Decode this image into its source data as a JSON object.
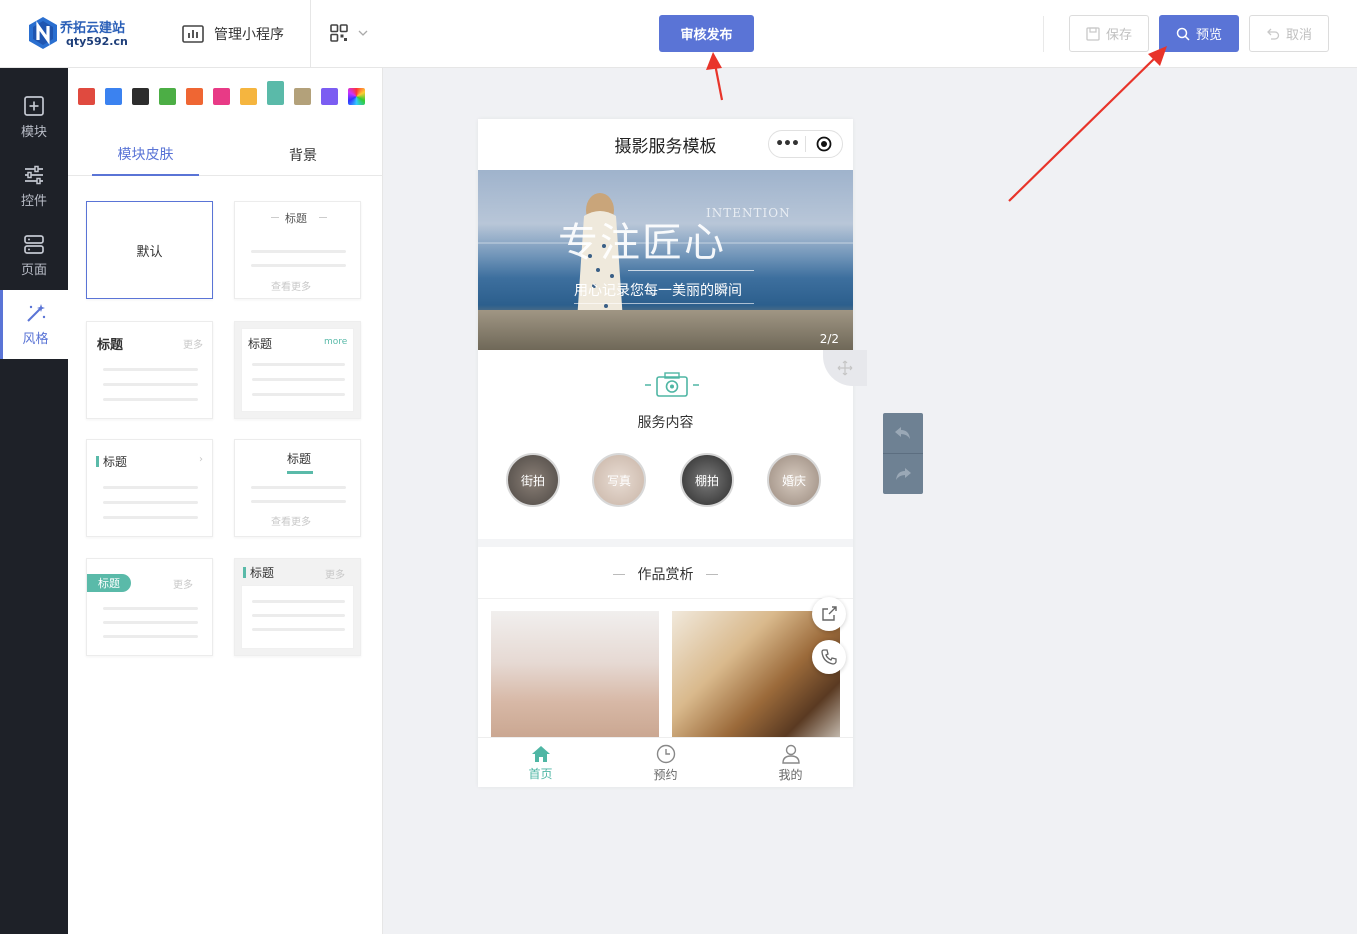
{
  "header": {
    "logo_line1": "乔拓云建站",
    "logo_line2": "qty592.cn",
    "manage_label": "管理小程序",
    "publish_label": "审核发布",
    "save_label": "保存",
    "preview_label": "预览",
    "cancel_label": "取消"
  },
  "leftnav": {
    "items": [
      {
        "label": "模块",
        "icon": "plus-square-icon"
      },
      {
        "label": "控件",
        "icon": "sliders-icon"
      },
      {
        "label": "页面",
        "icon": "pages-icon"
      },
      {
        "label": "风格",
        "icon": "magic-wand-icon"
      }
    ],
    "active": "风格"
  },
  "panel": {
    "colors": [
      "#e04a3f",
      "#3b82f0",
      "#2d2d2d",
      "#4cae45",
      "#ef6633",
      "#e83a86",
      "#f5b53f",
      "#5abaa9",
      "#b3a17a",
      "#7b5df2",
      "rainbow"
    ],
    "selected_color": "#5abaa9",
    "tabs": [
      "模块皮肤",
      "背景"
    ],
    "active_tab": "模块皮肤",
    "skins": {
      "default_label": "默认",
      "title": "标题",
      "more_cn": "更多",
      "more_en": "more",
      "view_more": "查看更多"
    }
  },
  "phone": {
    "title": "摄影服务模板",
    "banner": {
      "big_text": "专注匠心",
      "en_text": "INTENTION",
      "sub_text": "用心记录您每一美丽的瞬间",
      "index": "2/2"
    },
    "services": {
      "title": "服务内容",
      "items": [
        "街拍",
        "写真",
        "棚拍",
        "婚庆"
      ]
    },
    "works": {
      "title": "作品赏析"
    },
    "tabbar": [
      {
        "label": "首页",
        "icon": "home-icon"
      },
      {
        "label": "预约",
        "icon": "clock-icon"
      },
      {
        "label": "我的",
        "icon": "user-icon"
      }
    ],
    "accent": "#4fb6a4"
  },
  "colors": {
    "primary": "#5a74d6",
    "nav_bg": "#1e2128",
    "annotation_arrow": "#e8342a"
  }
}
